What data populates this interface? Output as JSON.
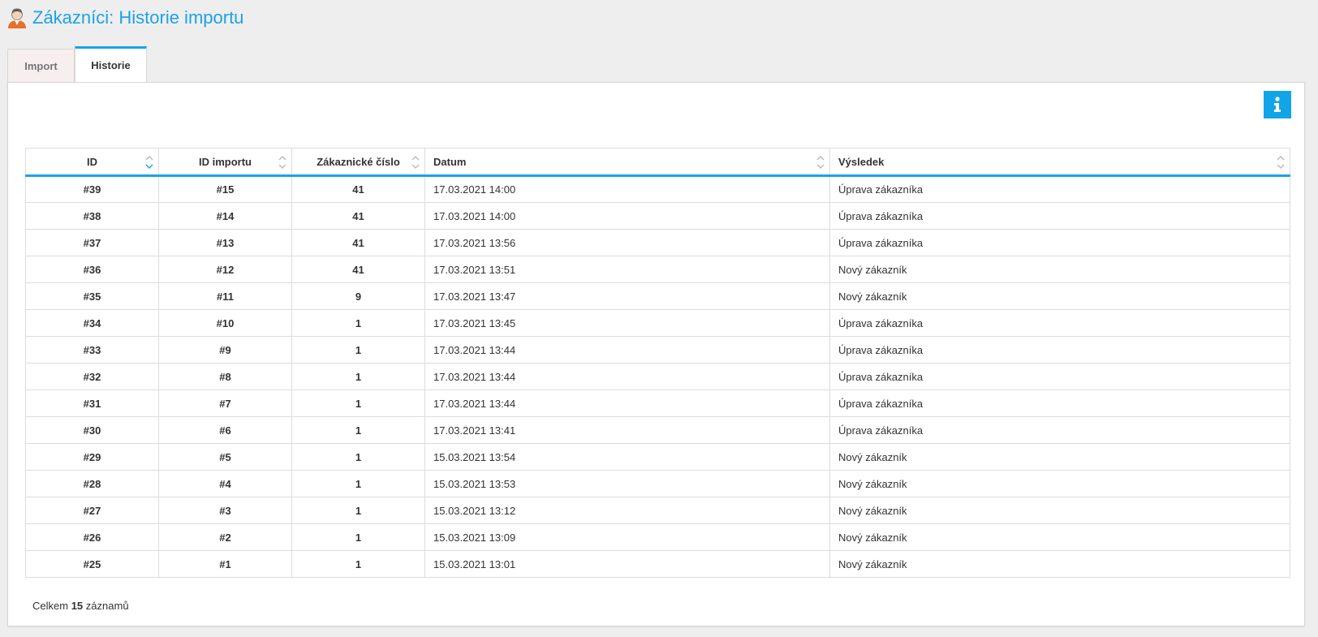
{
  "page": {
    "title": "Zákazníci: Historie importu",
    "title_icon": "customer-user-icon",
    "accent_color": "#1aa3e8"
  },
  "tabs": [
    {
      "label": "Import",
      "active": false
    },
    {
      "label": "Historie",
      "active": true
    }
  ],
  "info_button": {
    "icon": "info-icon",
    "color": "#11a5e8"
  },
  "table": {
    "columns": [
      "ID",
      "ID importu",
      "Zákaznické číslo",
      "Datum",
      "Výsledek"
    ],
    "rows": [
      [
        "#39",
        "#15",
        "41",
        "17.03.2021 14:00",
        "Úprava zákazníka"
      ],
      [
        "#38",
        "#14",
        "41",
        "17.03.2021 14:00",
        "Úprava zákazníka"
      ],
      [
        "#37",
        "#13",
        "41",
        "17.03.2021 13:56",
        "Úprava zákazníka"
      ],
      [
        "#36",
        "#12",
        "41",
        "17.03.2021 13:51",
        "Nový zákazník"
      ],
      [
        "#35",
        "#11",
        "9",
        "17.03.2021 13:47",
        "Nový zákazník"
      ],
      [
        "#34",
        "#10",
        "1",
        "17.03.2021 13:45",
        "Úprava zákazníka"
      ],
      [
        "#33",
        "#9",
        "1",
        "17.03.2021 13:44",
        "Úprava zákazníka"
      ],
      [
        "#32",
        "#8",
        "1",
        "17.03.2021 13:44",
        "Úprava zákazníka"
      ],
      [
        "#31",
        "#7",
        "1",
        "17.03.2021 13:44",
        "Úprava zákazníka"
      ],
      [
        "#30",
        "#6",
        "1",
        "17.03.2021 13:41",
        "Úprava zákazníka"
      ],
      [
        "#29",
        "#5",
        "1",
        "15.03.2021 13:54",
        "Nový zákazník"
      ],
      [
        "#28",
        "#4",
        "1",
        "15.03.2021 13:53",
        "Nový zákazník"
      ],
      [
        "#27",
        "#3",
        "1",
        "15.03.2021 13:12",
        "Nový zákazník"
      ],
      [
        "#26",
        "#2",
        "1",
        "15.03.2021 13:09",
        "Nový zákazník"
      ],
      [
        "#25",
        "#1",
        "1",
        "15.03.2021 13:01",
        "Nový zákazník"
      ]
    ]
  },
  "summary": {
    "prefix": "Celkem",
    "count": "15",
    "suffix": "záznamů"
  }
}
